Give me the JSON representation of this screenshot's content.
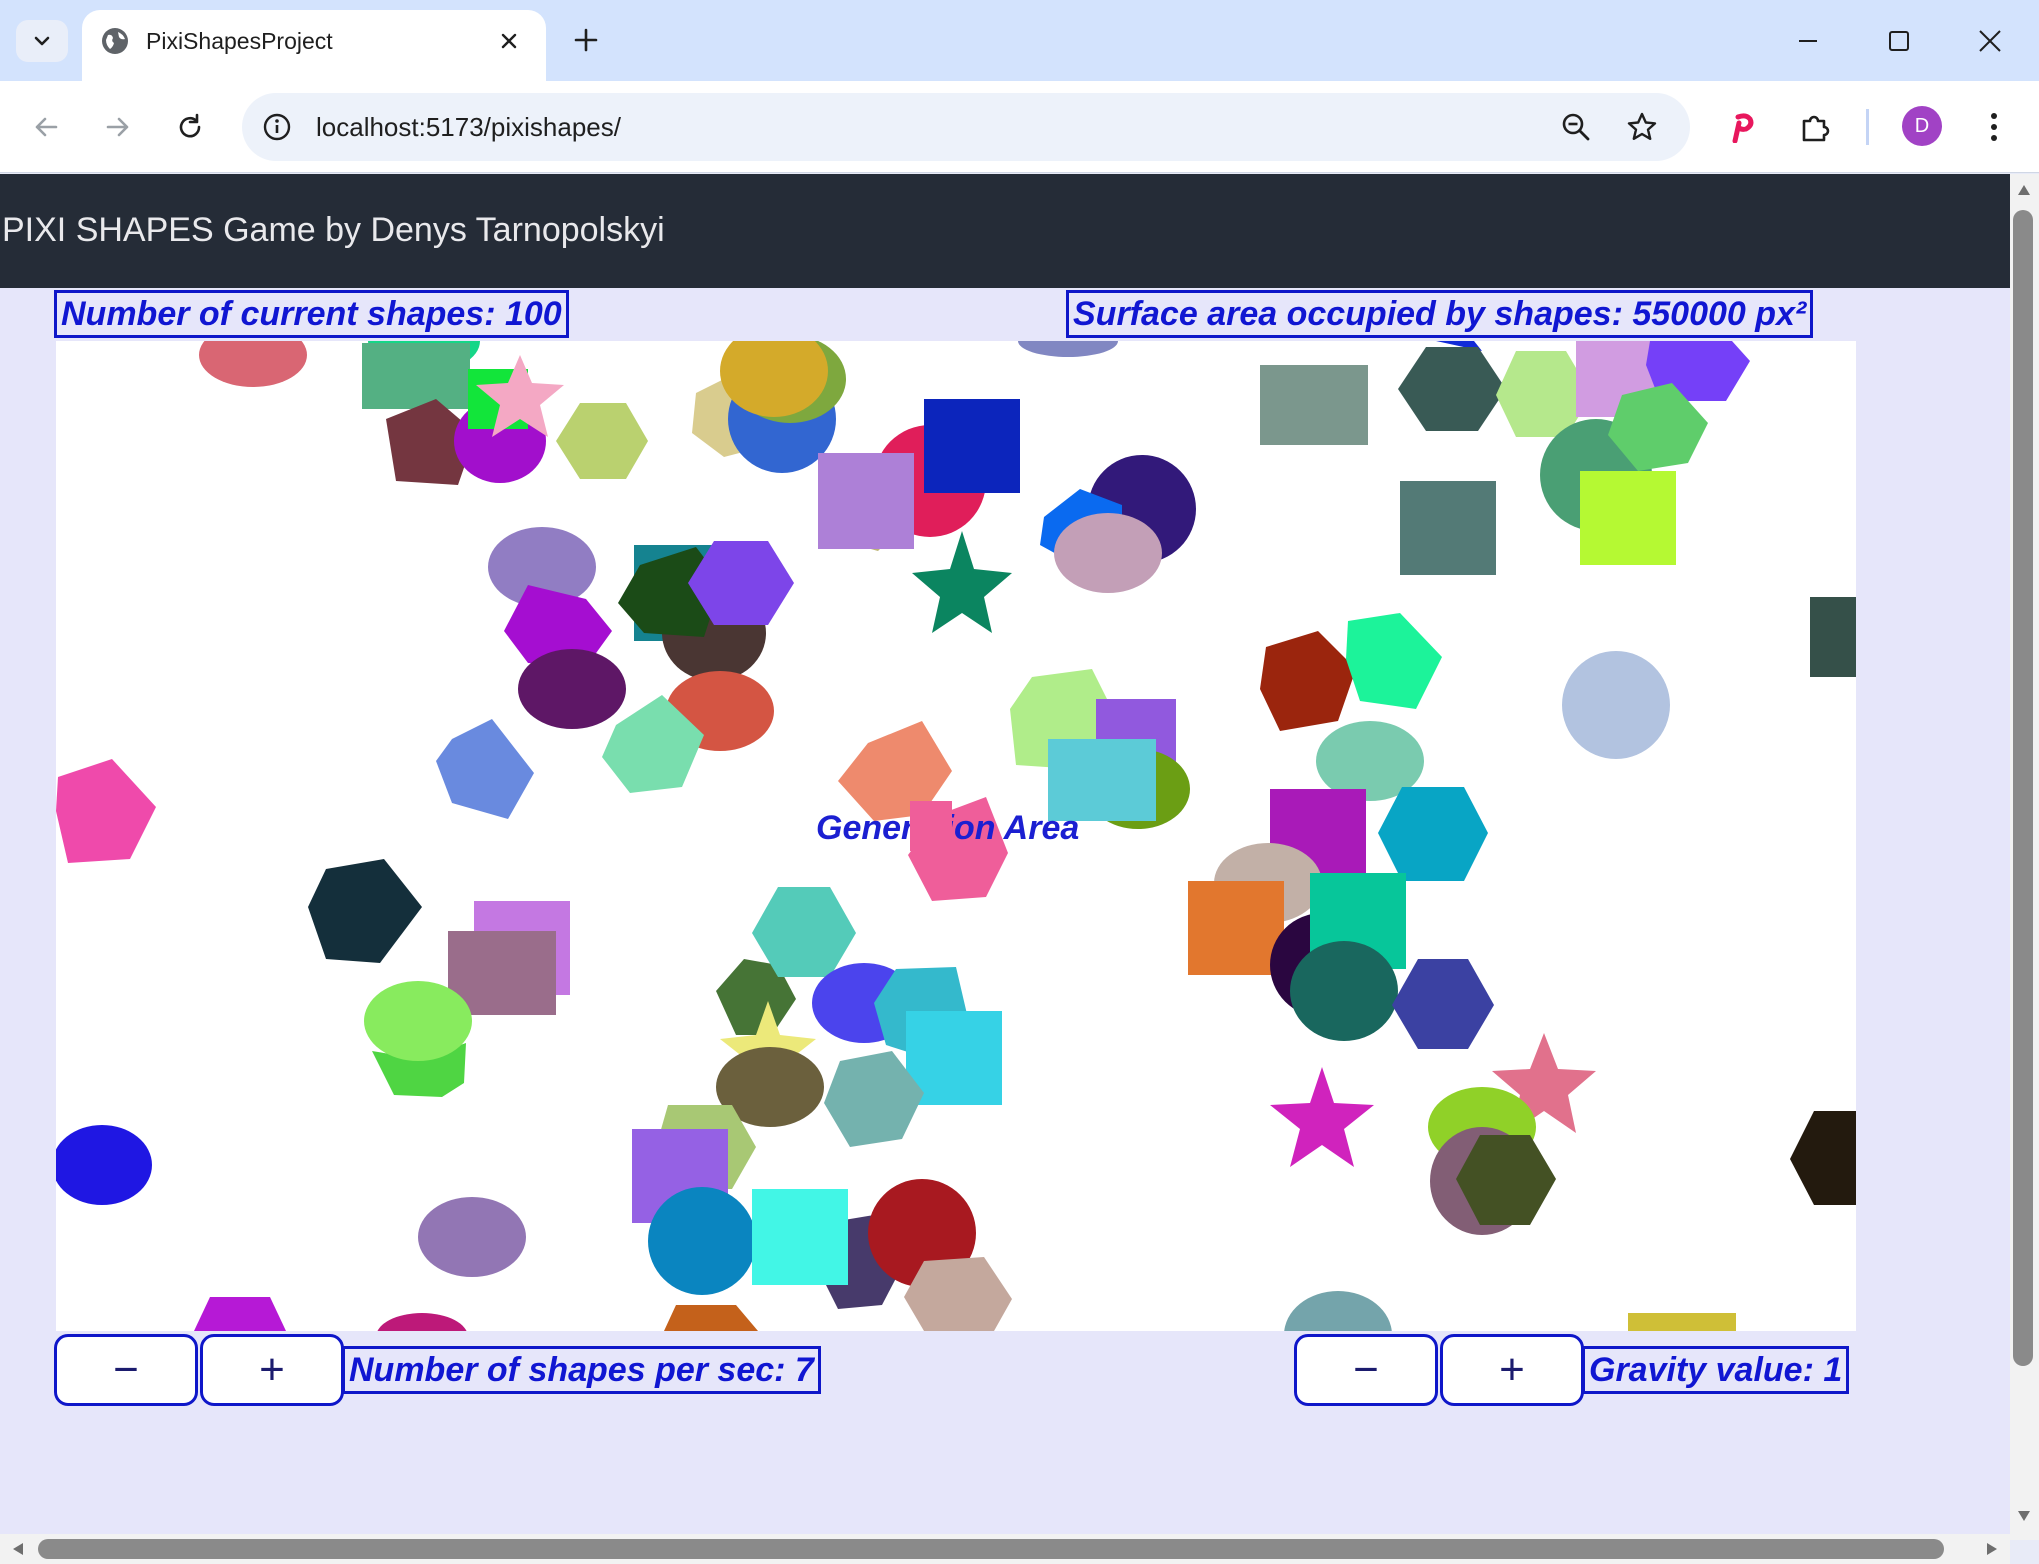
{
  "browser": {
    "tab_title": "PixiShapesProject",
    "url": "localhost:5173/pixishapes/",
    "profile_initial": "D"
  },
  "page": {
    "header_title": "PIXI SHAPES Game by Denys Tarnopolskyi",
    "shapes_count_label": "Number of current shapes: 100",
    "surface_area_label": "Surface area occupied by shapes: 550000 px²",
    "generation_area_label": "Generation Area",
    "shapes_per_sec_label": "Number of shapes per sec: 7",
    "gravity_label": "Gravity value: 1",
    "minus_label": "−",
    "plus_label": "+"
  },
  "colors": {
    "accent": "#0e16c9",
    "header_bg": "#252c37",
    "page_bg": "#e6e6fa"
  }
}
